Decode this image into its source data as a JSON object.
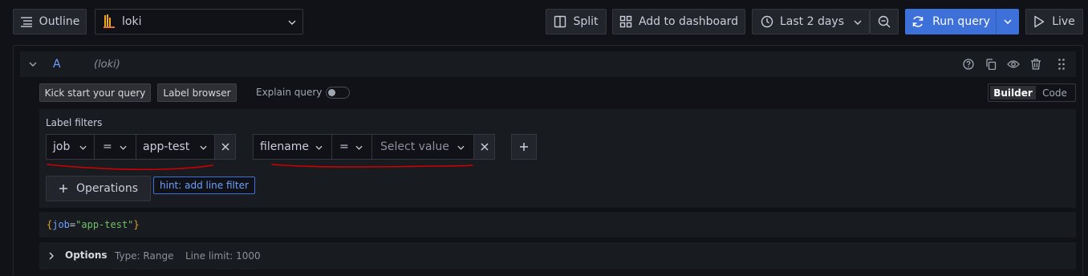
{
  "toolbar": {
    "outline_label": "Outline",
    "datasource": "loki",
    "split_label": "Split",
    "add_dashboard_label": "Add to dashboard",
    "time_range": "Last 2 days",
    "run_query_label": "Run query",
    "live_label": "Live"
  },
  "query_row": {
    "ref_id": "A",
    "datasource_hint": "(loki)"
  },
  "query_toolbar": {
    "kick_start_label": "Kick start your query",
    "label_browser_label": "Label browser",
    "explain_query_label": "Explain query",
    "builder_label": "Builder",
    "code_label": "Code"
  },
  "label_filters": {
    "title": "Label filters",
    "filters": [
      {
        "label": "job",
        "operator": "=",
        "value": "app-test"
      },
      {
        "label": "filename",
        "operator": "=",
        "value": "Select value"
      }
    ]
  },
  "operations": {
    "label": "Operations",
    "hint": "hint: add line filter"
  },
  "query_preview": {
    "open_brace": "{",
    "key": "job",
    "eq": "=",
    "value": "\"app-test\"",
    "close_brace": "}"
  },
  "options": {
    "label": "Options",
    "type": "Type: Range",
    "line_limit": "Line limit: 1000"
  },
  "colors": {
    "primary": "#3d71d9",
    "background": "#111217",
    "panel": "#181b1f",
    "annotation_red": "#d10000"
  }
}
